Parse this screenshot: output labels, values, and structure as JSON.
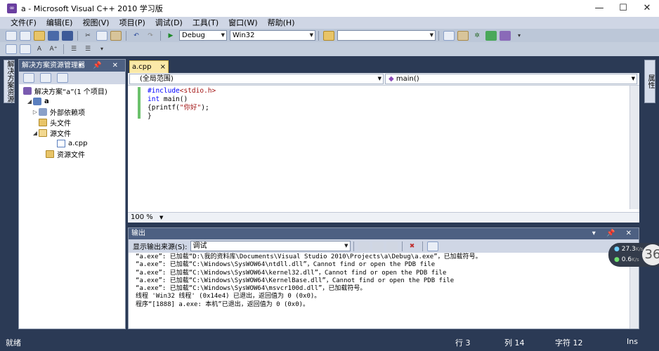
{
  "window": {
    "title": "a - Microsoft Visual C++ 2010 学习版",
    "controls": {
      "minimize": "—",
      "maximize": "☐",
      "close": "✕"
    }
  },
  "menu": [
    "文件(F)",
    "编辑(E)",
    "视图(V)",
    "项目(P)",
    "调试(D)",
    "工具(T)",
    "窗口(W)",
    "帮助(H)"
  ],
  "toolbar": {
    "config": "Debug",
    "platform": "Win32",
    "find_value": ""
  },
  "left_rail": {
    "tab": "解决方案资源"
  },
  "right_rail": {
    "tab": "属性"
  },
  "solution_explorer": {
    "title": "解决方案资源管理器",
    "header_controls": "▾ 📌 ✕",
    "tree": [
      {
        "label": "解决方案“a”(1 个项目)",
        "level": 0,
        "expander": "",
        "icon": "solution-icon"
      },
      {
        "label": "a",
        "level": 1,
        "expander": "◢",
        "icon": "project-icon"
      },
      {
        "label": "外部依赖项",
        "level": 2,
        "expander": "▷",
        "icon": "references-icon"
      },
      {
        "label": "头文件",
        "level": 2,
        "expander": "",
        "icon": "folder-icon"
      },
      {
        "label": "源文件",
        "level": 2,
        "expander": "◢",
        "icon": "folder-open-icon"
      },
      {
        "label": "a.cpp",
        "level": 3,
        "expander": "",
        "icon": "cpp-file-icon"
      },
      {
        "label": "资源文件",
        "level": 2,
        "expander": "",
        "icon": "folder-icon"
      }
    ]
  },
  "editor": {
    "tab_label": "a.cpp",
    "tab_close": "×",
    "scope_left": "(全局范围)",
    "scope_right": "main()",
    "zoom": "100 %",
    "code_lines": [
      {
        "segments": [
          {
            "text": "#include",
            "cls": "pp"
          },
          {
            "text": "<stdio.h>",
            "cls": "str"
          }
        ]
      },
      {
        "segments": [
          {
            "text": "int",
            "cls": "kw"
          },
          {
            "text": " main()",
            "cls": ""
          }
        ]
      },
      {
        "segments": [
          {
            "text": "{printf(",
            "cls": ""
          },
          {
            "text": "\"你好\"",
            "cls": "str"
          },
          {
            "text": ");",
            "cls": ""
          }
        ]
      },
      {
        "segments": [
          {
            "text": "}",
            "cls": ""
          }
        ]
      }
    ]
  },
  "output": {
    "title": "输出",
    "header_controls": "▾ 📌 ✕",
    "source_label": "显示输出来源(S):",
    "source_value": "调试",
    "lines": [
      "“a.exe”: 已加载“D:\\我的资料库\\Documents\\Visual Studio 2010\\Projects\\a\\Debug\\a.exe”，已加载符号。",
      "“a.exe”: 已加载“C:\\Windows\\SysWOW64\\ntdll.dll”，Cannot find or open the PDB file",
      "“a.exe”: 已加载“C:\\Windows\\SysWOW64\\kernel32.dll”，Cannot find or open the PDB file",
      "“a.exe”: 已加载“C:\\Windows\\SysWOW64\\KernelBase.dll”，Cannot find or open the PDB file",
      "“a.exe”: 已加载“C:\\Windows\\SysWOW64\\msvcr100d.dll”，已加载符号。",
      "线程 'Win32 线程' (0x14e4) 已退出，返回值为 0 (0x0)。",
      "程序“[1888] a.exe: 本机”已退出，返回值为 0 (0x0)。"
    ]
  },
  "status": {
    "ready": "就绪",
    "line": "行 3",
    "col": "列 14",
    "char": "字符 12",
    "mode": "Ins"
  },
  "net_widget": {
    "up": "27.3",
    "up_unit": "K/s",
    "down": "0.6",
    "down_unit": "K/s",
    "badge": "36"
  }
}
